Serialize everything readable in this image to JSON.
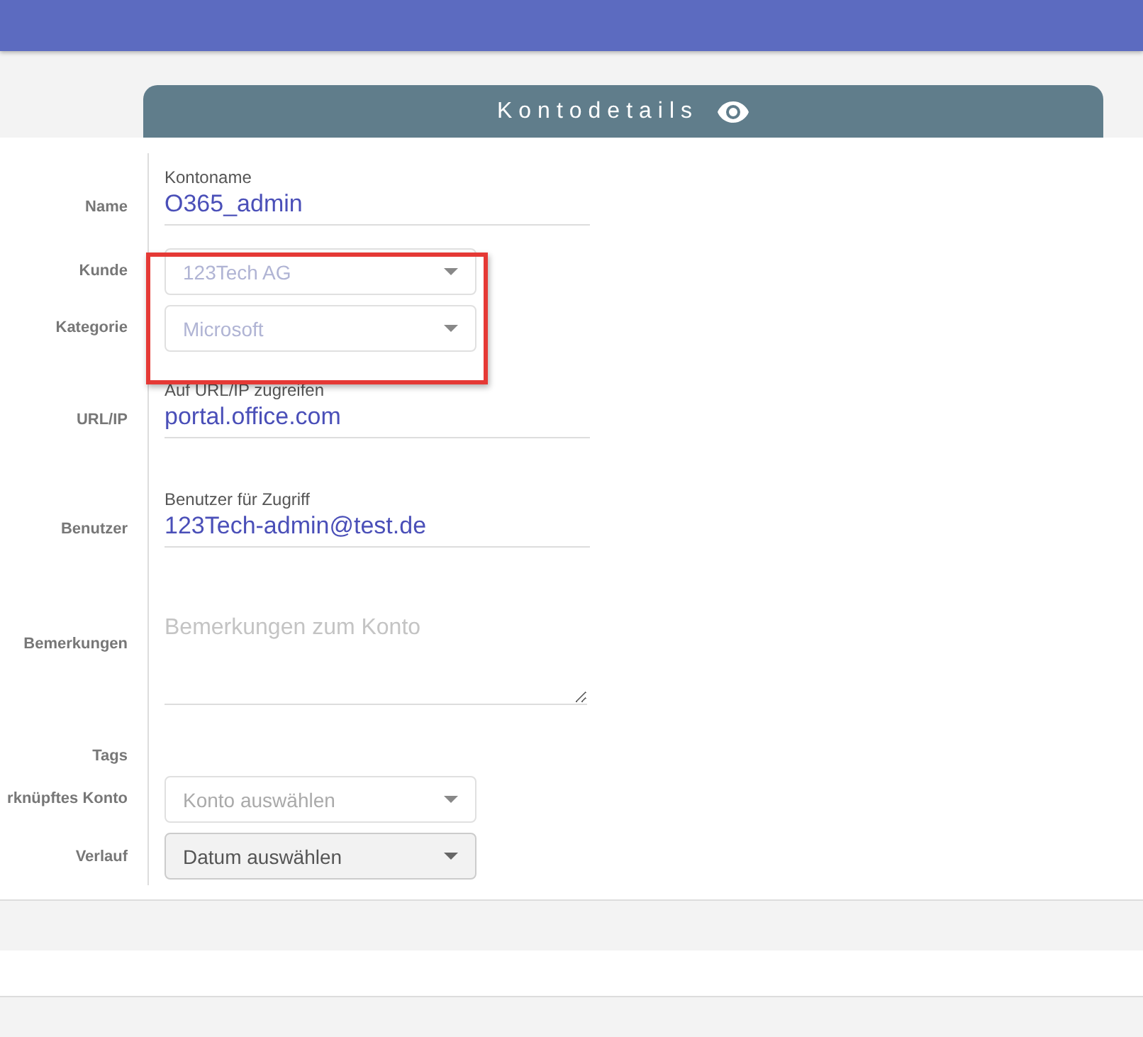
{
  "header": {
    "title": "Kontodetails"
  },
  "fields": [
    {
      "label": "Name",
      "kind": "text",
      "caption": "Kontoname",
      "value": "O365_admin"
    },
    {
      "label": "Kunde",
      "kind": "select",
      "value": "123Tech AG",
      "disabled": true
    },
    {
      "label": "Kategorie",
      "kind": "select",
      "value": "Microsoft",
      "disabled": true
    },
    {
      "label": "URL/IP",
      "kind": "text",
      "caption": "Auf URL/IP zugreifen",
      "value": "portal.office.com"
    },
    {
      "label": "Benutzer",
      "kind": "text",
      "caption": "Benutzer für Zugriff",
      "value": "123Tech-admin@test.de"
    },
    {
      "label": "Bemerkungen",
      "kind": "textarea",
      "placeholder": "Bemerkungen zum Konto"
    },
    {
      "label": "Tags",
      "kind": "empty"
    },
    {
      "label": "rknüpftes Konto",
      "kind": "select",
      "placeholder": "Konto auswählen"
    },
    {
      "label": "Verlauf",
      "kind": "dropdown",
      "value": "Datum auswählen"
    }
  ]
}
